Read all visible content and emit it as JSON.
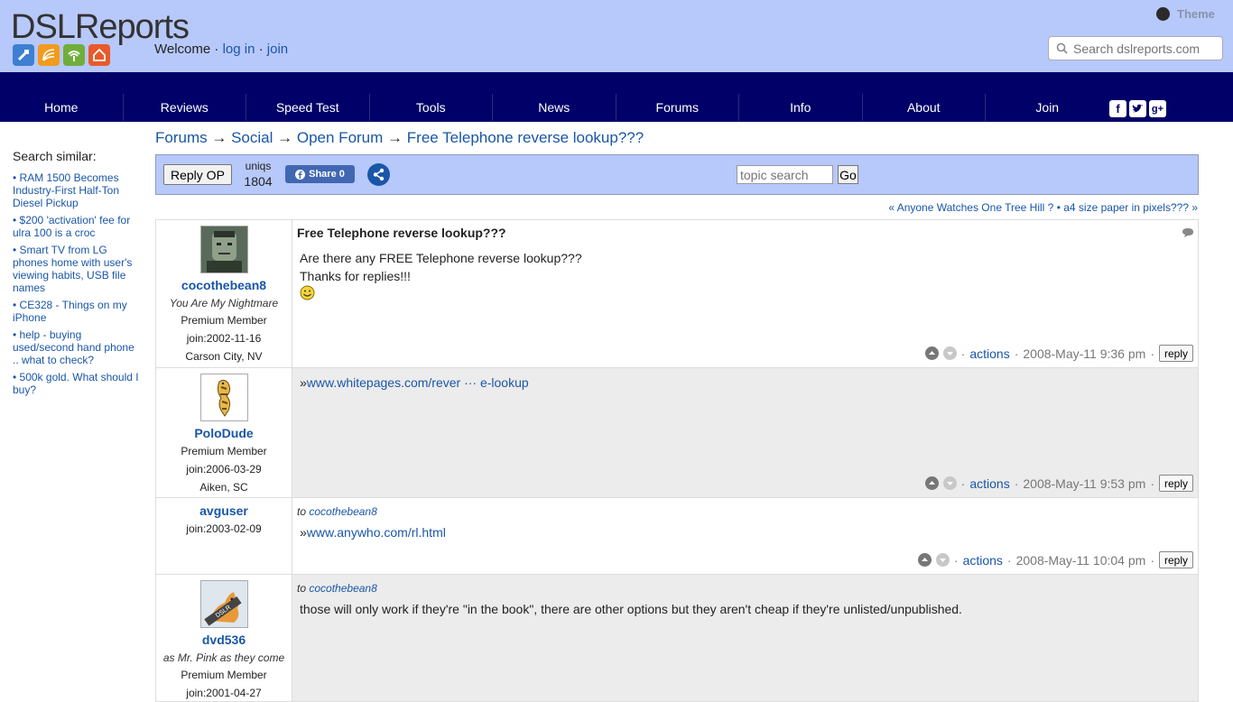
{
  "header": {
    "logo_text": "DSLReports",
    "welcome": "Welcome",
    "login": "log in",
    "join": "join",
    "theme": "Theme",
    "search_placeholder": "Search dslreports.com"
  },
  "nav": [
    "Home",
    "Reviews",
    "Speed Test",
    "Tools",
    "News",
    "Forums",
    "Info",
    "About",
    "Join"
  ],
  "sidebar": {
    "heading": "Search similar:",
    "links": [
      "• RAM 1500 Becomes Industry-First Half-Ton Diesel Pickup",
      "• $200 'activation' fee for ulra 100 is a croc",
      "• Smart TV from LG phones home with user's viewing habits, USB file names",
      "• CE328 - Things on my iPhone",
      "• help - buying used/second hand phone .. what to check?",
      "• 500k gold. What should I buy?"
    ]
  },
  "breadcrumb": {
    "forums": "Forums",
    "social": "Social",
    "open_forum": "Open Forum",
    "topic": "Free Telephone reverse lookup???",
    "arrow": "→"
  },
  "toolbar": {
    "reply_op": "Reply OP",
    "uniqs_label": "uniqs",
    "uniqs_value": "1804",
    "share": "Share 0",
    "topic_search_placeholder": "topic search",
    "go": "Go"
  },
  "thread_nav": {
    "prev": "« Anyone Watches One Tree Hill ?",
    "sep": "•",
    "next": "a4 size paper in pixels??? »"
  },
  "posts": [
    {
      "username": "cocothebean8",
      "user_title": "You Are My Nightmare",
      "rank": "Premium Member",
      "join": "join:2002-11-16",
      "location": "Carson City, NV",
      "title": "Free Telephone reverse lookup???",
      "text1": "Are there any FREE Telephone reverse lookup???",
      "text2": "Thanks for replies!!!",
      "actions": "actions",
      "time": "2008-May-11 9:36 pm",
      "reply": "reply"
    },
    {
      "username": "PoloDude",
      "rank": "Premium Member",
      "join": "join:2006-03-29",
      "location": "Aiken, SC",
      "link_prefix": "»",
      "link": "www.whitepages.com/rever ··· e-lookup",
      "actions": "actions",
      "time": "2008-May-11 9:53 pm",
      "reply": "reply"
    },
    {
      "username": "avguser",
      "join": "join:2003-02-09",
      "to_label": "to",
      "to_user": "cocothebean8",
      "link_prefix": "»",
      "link": "www.anywho.com/rl.html",
      "actions": "actions",
      "time": "2008-May-11 10:04 pm",
      "reply": "reply"
    },
    {
      "username": "dvd536",
      "user_title": "as Mr. Pink as they come",
      "rank": "Premium Member",
      "join": "join:2001-04-27",
      "to_label": "to",
      "to_user": "cocothebean8",
      "text": "those will only work if they're \"in the book\", there are other options but they aren't cheap if they're unlisted/unpublished."
    }
  ],
  "colors": {
    "header_bg": "#b7c8fa",
    "nav_bg": "#000068",
    "link": "#1a56a8"
  }
}
